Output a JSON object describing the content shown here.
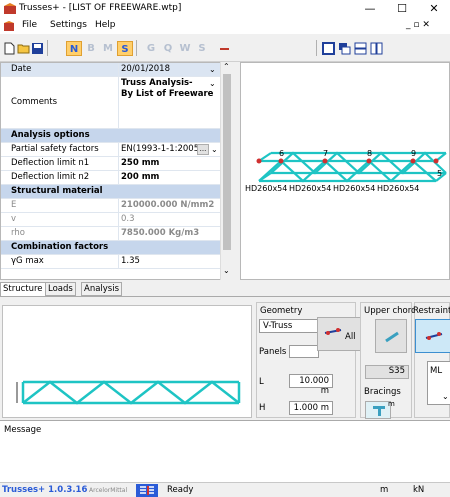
{
  "window": {
    "title": "Trusses+ - [LIST OF FREEWARE.wtp]",
    "minimize": "—",
    "maximize": "☐",
    "close": "✕",
    "mdi_restore": "_ ▫ ✕"
  },
  "menu": {
    "items": [
      "File",
      "Settings",
      "Help"
    ]
  },
  "toolbar": {
    "letters": [
      "N",
      "B",
      "M",
      "S",
      "G",
      "Q",
      "W",
      "S"
    ]
  },
  "properties": {
    "rows": [
      {
        "key": "Date",
        "value": "20/01/2018"
      },
      {
        "key": "Comments",
        "value": "Truss Analysis-\nBy List of Freeware"
      },
      {
        "key": "Analysis options",
        "value": ""
      },
      {
        "key": "Partial safety factors",
        "value": "EN(1993-1-1:2005"
      },
      {
        "key": "Deflection limit n1",
        "value": "250 mm"
      },
      {
        "key": "Deflection limit n2",
        "value": "200 mm"
      },
      {
        "key": "Structural material",
        "value": ""
      },
      {
        "key": "E",
        "value": "210000.000 N/mm2"
      },
      {
        "key": "v",
        "value": "0.3"
      },
      {
        "key": "rho",
        "value": "7850.000 Kg/m3"
      },
      {
        "key": "Combination factors",
        "value": ""
      },
      {
        "key": "γG max",
        "value": "1.35"
      }
    ],
    "ellipsis": "..."
  },
  "view3d": {
    "node_labels": [
      "6",
      "7",
      "8",
      "9",
      "5"
    ],
    "member_label": "HD260x54"
  },
  "tabs": [
    "Structure",
    "Loads",
    "Analysis"
  ],
  "geometry": {
    "header": "Geometry",
    "type": "V-Truss",
    "panels_label": "Panels",
    "panels_value": "",
    "L_label": "L",
    "L_value": "10.000 m",
    "H_label": "H",
    "H_value": "1.000 m",
    "all_button": "All"
  },
  "upper_chord": {
    "header": "Upper chord",
    "grade": "S35",
    "bracings_label": "Bracings"
  },
  "restraints": {
    "header": "Restraint",
    "value": "ML"
  },
  "message": {
    "label": "Message"
  },
  "status": {
    "app": "Trusses+ 1.0.3.16",
    "brand": "ArcelorMittal",
    "state": "Ready",
    "unit1": "m",
    "unit2": "kN"
  }
}
